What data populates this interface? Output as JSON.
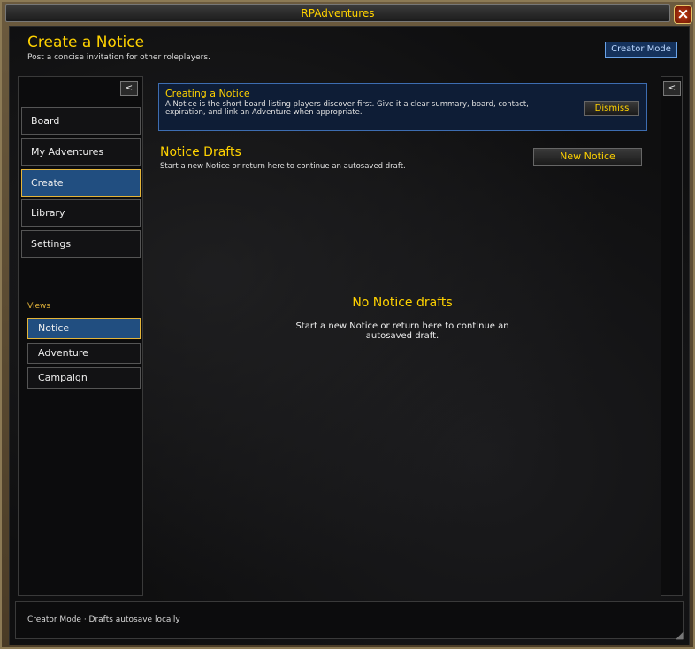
{
  "window": {
    "title": "RPAdventures",
    "close_icon": "close-icon"
  },
  "header": {
    "title": "Create a Notice",
    "subtitle": "Post a concise invitation for other roleplayers.",
    "creator_mode_label": "Creator Mode"
  },
  "sidebar": {
    "collapse_label": "<",
    "items": [
      {
        "label": "Board",
        "active": false
      },
      {
        "label": "My Adventures",
        "active": false
      },
      {
        "label": "Create",
        "active": true
      },
      {
        "label": "Library",
        "active": false
      },
      {
        "label": "Settings",
        "active": false
      }
    ],
    "views_label": "Views",
    "views": [
      {
        "label": "Notice",
        "active": true
      },
      {
        "label": "Adventure",
        "active": false
      },
      {
        "label": "Campaign",
        "active": false
      }
    ]
  },
  "info_panel": {
    "title": "Creating a Notice",
    "text": "A Notice is the short board listing players discover first. Give it a clear summary, board, contact, expiration, and link an Adventure when appropriate.",
    "dismiss_label": "Dismiss"
  },
  "drafts": {
    "title": "Notice Drafts",
    "subtitle": "Start a new Notice or return here to continue an autosaved draft.",
    "new_label": "New Notice",
    "empty_title": "No Notice drafts",
    "empty_text": "Start a new Notice or return here to continue an autosaved draft."
  },
  "right_rail": {
    "collapse_label": "<"
  },
  "footer": {
    "status": "Creator Mode · Drafts autosave locally"
  },
  "colors": {
    "accent_gold": "#ffd200",
    "active_blue": "#214e80",
    "info_border": "#3d6db1"
  }
}
